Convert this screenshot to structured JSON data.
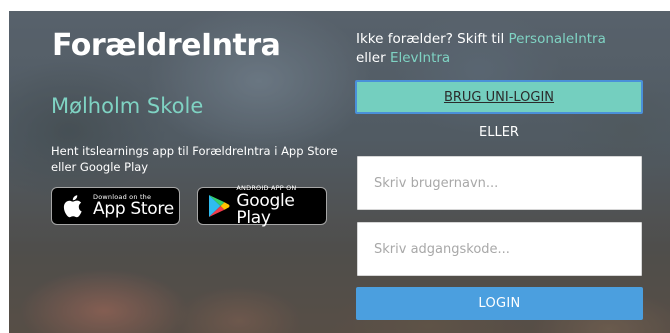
{
  "logo_text": "ForældreIntra",
  "school_name": "Mølholm Skole",
  "app_promo": {
    "text": "Hent itslearnings app til ForældreIntra i App Store eller Google Play",
    "app_store": {
      "small": "Download on the",
      "big": "App Store",
      "icon": "apple-icon"
    },
    "google_play": {
      "small": "ANDROID APP ON",
      "big": "Google Play",
      "icon": "google-play-icon"
    }
  },
  "switch": {
    "prefix": "Ikke forælder? Skift til ",
    "link1": "PersonaleIntra",
    "middle": "eller ",
    "link2": "ElevIntra"
  },
  "login": {
    "uni_login_label": "BRUG UNI-LOGIN",
    "or_label": "ELLER",
    "username_placeholder": "Skriv brugernavn...",
    "username_value": "",
    "password_placeholder": "Skriv adgangskode...",
    "password_value": "",
    "submit_label": "LOGIN"
  },
  "colors": {
    "accent_mint": "#7fd3c3",
    "uni_button": "#74cfbf",
    "uni_button_border": "#4a90d9",
    "login_button": "#4b9fdf"
  }
}
